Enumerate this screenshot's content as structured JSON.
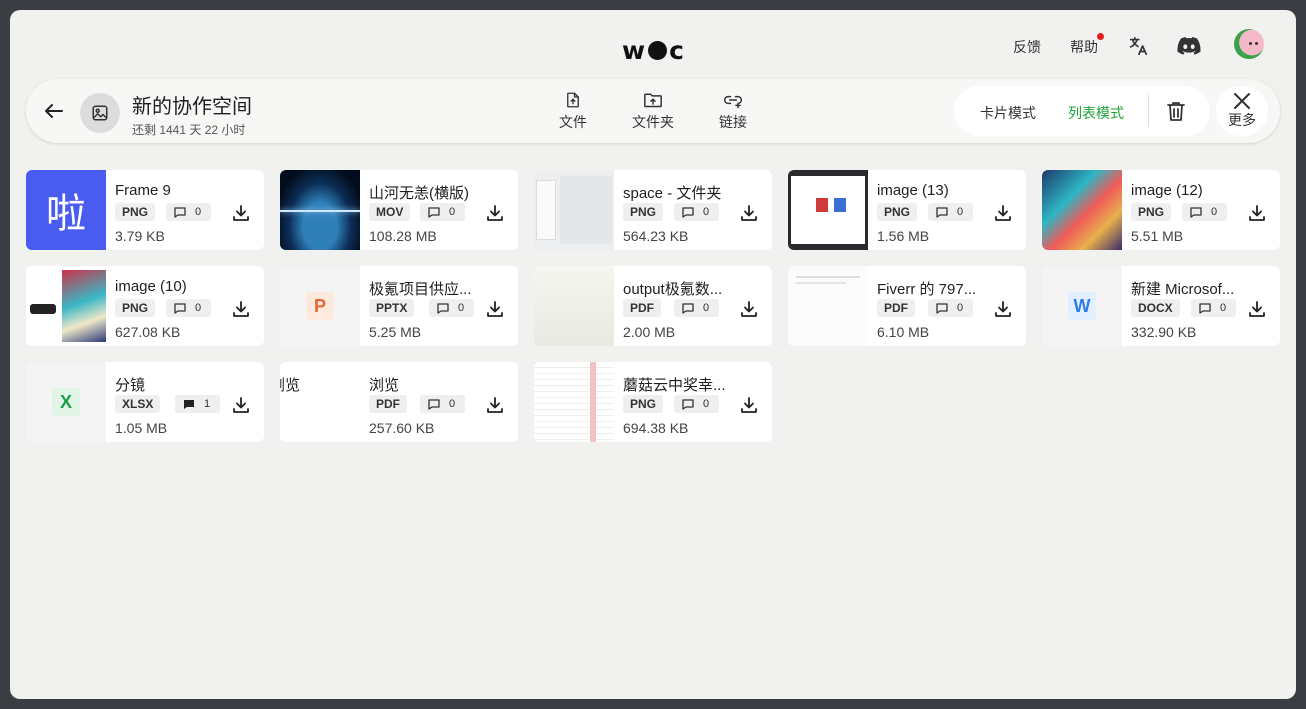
{
  "top": {
    "logo_left": "w",
    "logo_right": "c",
    "feedback": "反馈",
    "help": "帮助",
    "icons": [
      "translate-icon",
      "discord-icon",
      "avatar"
    ]
  },
  "header": {
    "title": "新的协作空间",
    "subtitle": "还剩 1441 天 22 小时",
    "tools": {
      "file": "文件",
      "folder": "文件夹",
      "link": "链接"
    },
    "mode_card": "卡片模式",
    "mode_list": "列表模式",
    "more": "更多",
    "accent": "#1ea338"
  },
  "files": [
    {
      "name": "Frame 9",
      "type": "PNG",
      "comments": "0",
      "size": "3.79 KB",
      "thumb": "la",
      "thumb_text": "啦"
    },
    {
      "name": "山河无恙(横版)",
      "type": "MOV",
      "comments": "0",
      "size": "108.28 MB",
      "thumb": "earth"
    },
    {
      "name": "space - 文件夹",
      "type": "PNG",
      "comments": "0",
      "size": "564.23 KB",
      "thumb": "screen"
    },
    {
      "name": "image (13)",
      "type": "PNG",
      "comments": "0",
      "size": "1.56 MB",
      "thumb": "screen2"
    },
    {
      "name": "image (12)",
      "type": "PNG",
      "comments": "0",
      "size": "5.51 MB",
      "thumb": "art"
    },
    {
      "name": "image (10)",
      "type": "PNG",
      "comments": "0",
      "size": "627.08 KB",
      "thumb": "art2"
    },
    {
      "name": "极氪项目供应...",
      "type": "PPTX",
      "comments": "0",
      "size": "5.25 MB",
      "thumb": "pptx",
      "thumb_text": "P"
    },
    {
      "name": "output极氪数...",
      "type": "PDF",
      "comments": "0",
      "size": "2.00 MB",
      "thumb": "pdf"
    },
    {
      "name": "Fiverr 的 797...",
      "type": "PDF",
      "comments": "0",
      "size": "6.10 MB",
      "thumb": "blank"
    },
    {
      "name": "新建 Microsof...",
      "type": "DOCX",
      "comments": "0",
      "size": "332.90 KB",
      "thumb": "docx",
      "thumb_text": "W"
    },
    {
      "name": "分镜",
      "type": "XLSX",
      "comments": "1",
      "size": "1.05 MB",
      "thumb": "xlsx",
      "thumb_text": "X"
    },
    {
      "name": "浏览",
      "type": "PDF",
      "comments": "0",
      "size": "257.60 KB",
      "thumb": "text",
      "thumb_text": "浏览"
    },
    {
      "name": "蘑菇云中奖幸...",
      "type": "PNG",
      "comments": "0",
      "size": "694.38 KB",
      "thumb": "sheet"
    }
  ]
}
